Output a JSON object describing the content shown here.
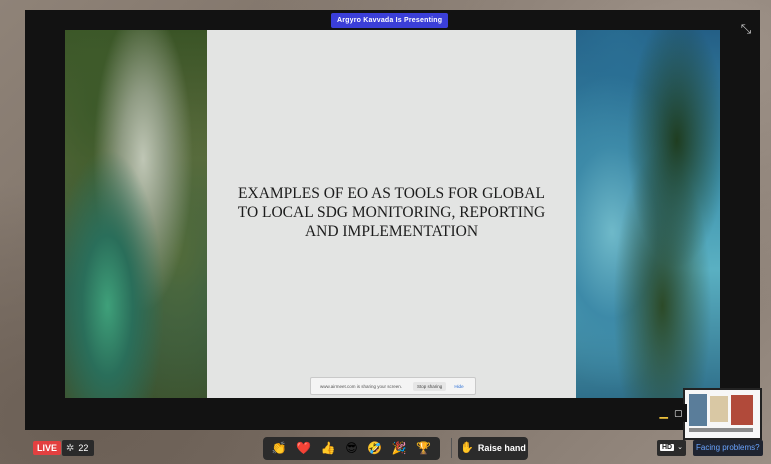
{
  "presenter": {
    "label": "Argyro Kavvada Is Presenting"
  },
  "slide": {
    "title_lines": [
      "EXAMPLES OF EO AS TOOLS FOR GLOBAL",
      "TO LOCAL SDG MONITORING, REPORTING",
      "AND IMPLEMENTATION"
    ]
  },
  "share_banner": {
    "message": "www.airmeet.com is sharing your screen.",
    "stop_label": "Stop sharing",
    "hide_label": "Hide"
  },
  "toolbar": {
    "live_label": "LIVE",
    "viewer_count": "22",
    "reactions": [
      "👏",
      "❤️",
      "👍",
      "😎",
      "🤣",
      "🎉",
      "🏆"
    ],
    "raise_hand_label": "Raise hand",
    "quality_label": "HD",
    "facing_problems_label": "Facing problems?"
  },
  "colors": {
    "presenter_badge": "#3b3fd8",
    "live_badge": "#e34040",
    "link": "#6aa4ff"
  },
  "icons": {
    "collapse": "collapse-icon",
    "viewers": "viewers-icon",
    "hand": "hand-icon"
  }
}
